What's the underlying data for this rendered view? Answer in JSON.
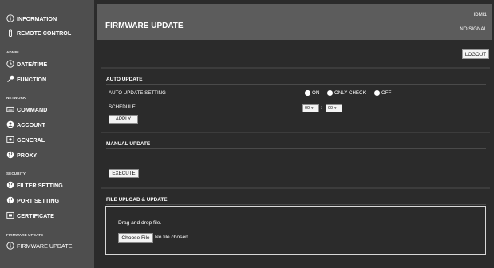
{
  "sidebar": {
    "information": "INFORMATION",
    "remote_control": "REMOTE CONTROL",
    "admin_label": "ADMIN",
    "date_time": "DATE/TIME",
    "function": "FUNCTION",
    "network_label": "NETWORK",
    "command": "COMMAND",
    "account": "ACCOUNT",
    "general": "GENERAL",
    "proxy": "PROXY",
    "security_label": "SECURITY",
    "filter_setting": "FILTER SETTING",
    "port_setting": "PORT SETTING",
    "certificate": "CERTIFICATE",
    "firmware_label": "FIRMWARE UPDATE",
    "firmware_update": "FIRMWARE UPDATE"
  },
  "header": {
    "title": "FIRMWARE UPDATE",
    "input": "HDMI1",
    "signal": "NO SIGNAL"
  },
  "logout_label": "LOGOUT",
  "auto_update": {
    "title": "AUTO UPDATE",
    "setting_label": "AUTO UPDATE SETTING",
    "options": [
      "ON",
      "ONLY CHECK",
      "OFF"
    ],
    "selected": "ON",
    "schedule_label": "SCHEDULE",
    "hour": "00",
    "minute": "00",
    "separator": ":",
    "apply_label": "APPLY"
  },
  "manual_update": {
    "title": "MANUAL UPDATE",
    "execute_label": "EXECUTE"
  },
  "file_upload": {
    "title": "FILE UPLOAD & UPDATE",
    "drop_text": "Drag and drop file.",
    "choose_label": "Choose File",
    "no_file": "No file chosen"
  }
}
